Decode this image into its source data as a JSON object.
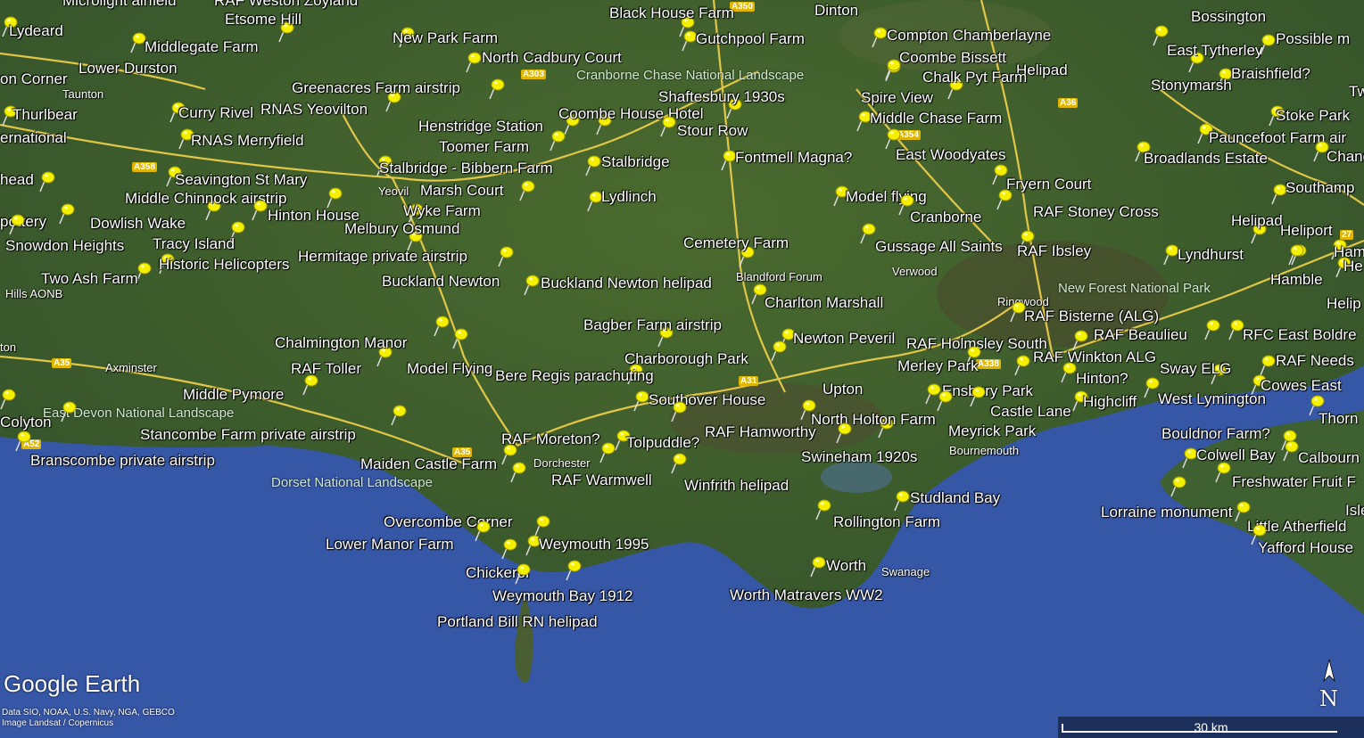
{
  "app": {
    "logo_text": "Google Earth"
  },
  "credits": {
    "line1": "Data SIO, NOAA, U.S. Navy, NGA, GEBCO",
    "line2": "Image Landsat / Copernicus"
  },
  "scale": {
    "label": "30 km"
  },
  "compass": {
    "letter": "N",
    "icon": "north-arrow-icon"
  },
  "colors": {
    "land": "#3c5c2a",
    "sea": "#3656a6",
    "road": "#f3d24a",
    "pin": "#f5f000"
  },
  "places": [
    {
      "name": "Middlegate Farm"
    },
    {
      "name": "Lower Durston"
    },
    {
      "name": "Etsome Hill"
    },
    {
      "name": "New Park Farm"
    },
    {
      "name": "North Cadbury Court"
    },
    {
      "name": "Black House Farm"
    },
    {
      "name": "Gutchpool Farm"
    },
    {
      "name": "Dinton"
    },
    {
      "name": "Compton Chamberlayne"
    },
    {
      "name": "Coombe Bissett"
    },
    {
      "name": "Helipad"
    },
    {
      "name": "Bossington"
    },
    {
      "name": "East Tytherley"
    },
    {
      "name": "Possible m"
    },
    {
      "name": "Braishfield?"
    },
    {
      "name": "Stonymarsh"
    },
    {
      "name": "Lydeard"
    },
    {
      "name": "on Corner"
    },
    {
      "name": "Thurlbear"
    },
    {
      "name": "ernational"
    },
    {
      "name": "Curry Rivel"
    },
    {
      "name": "RNAS Yeovilton"
    },
    {
      "name": "Greenacres Farm airstrip"
    },
    {
      "name": "RNAS Merryfield"
    },
    {
      "name": "Henstridge Station"
    },
    {
      "name": "Coombe House Hotel"
    },
    {
      "name": "Shaftesbury 1930s"
    },
    {
      "name": "Stour Row"
    },
    {
      "name": "Toomer Farm"
    },
    {
      "name": "Chalk Pyt Farm"
    },
    {
      "name": "Spire View"
    },
    {
      "name": "Middle Chase Farm"
    },
    {
      "name": "Stoke Park"
    },
    {
      "name": "Pauncefoot Farm air"
    },
    {
      "name": "Broadlands Estate"
    },
    {
      "name": "Chandle"
    },
    {
      "name": "head"
    },
    {
      "name": "Seavington St Mary"
    },
    {
      "name": "Stalbridge - Bibbern Farm"
    },
    {
      "name": "Stalbridge"
    },
    {
      "name": "Fontmell Magna?"
    },
    {
      "name": "East Woodyates"
    },
    {
      "name": "Fryern Court"
    },
    {
      "name": "Southamp"
    },
    {
      "name": "Middle  Chinnock airstrip"
    },
    {
      "name": "Marsh Court"
    },
    {
      "name": "Lydlinch"
    },
    {
      "name": "Model flying"
    },
    {
      "name": "Hinton House"
    },
    {
      "name": "Wyke Farm"
    },
    {
      "name": "Cranborne"
    },
    {
      "name": "RAF Stoney Cross"
    },
    {
      "name": "Helipad"
    },
    {
      "name": "Heliport"
    },
    {
      "name": "pottery"
    },
    {
      "name": "Dowlish Wake"
    },
    {
      "name": "Melbury Osmund"
    },
    {
      "name": "Snowdon Heights"
    },
    {
      "name": "Tracy Island"
    },
    {
      "name": "Cemetery Farm"
    },
    {
      "name": "Gussage All Saints"
    },
    {
      "name": "RAF Ibsley"
    },
    {
      "name": "Lyndhurst"
    },
    {
      "name": "Hamble"
    },
    {
      "name": "Hermitage private airstrip"
    },
    {
      "name": "Historic Helicopters"
    },
    {
      "name": "Two Ash Farm"
    },
    {
      "name": "Buckland Newton"
    },
    {
      "name": "Buckland Newton helipad"
    },
    {
      "name": "Hamble"
    },
    {
      "name": "Charlton Marshall"
    },
    {
      "name": "Helip"
    },
    {
      "name": "RAF Bisterne (ALG)"
    },
    {
      "name": "Bagber Farm airstrip"
    },
    {
      "name": "RAF Beaulieu"
    },
    {
      "name": "RFC East Boldre"
    },
    {
      "name": "Chalmington Manor"
    },
    {
      "name": "Newton Peveril"
    },
    {
      "name": "RAF Holmsley South"
    },
    {
      "name": "Charborough Park"
    },
    {
      "name": "RAF Winkton ALG"
    },
    {
      "name": "RAF Toller"
    },
    {
      "name": "Model Flying"
    },
    {
      "name": "Merley Park"
    },
    {
      "name": "Sway ELG"
    },
    {
      "name": "RAF Needs"
    },
    {
      "name": "Bere Regis parachuting"
    },
    {
      "name": "Hinton?"
    },
    {
      "name": "Cowes East"
    },
    {
      "name": "Middle Pymore"
    },
    {
      "name": "Upton"
    },
    {
      "name": "Ensbury Park"
    },
    {
      "name": "West Lymington"
    },
    {
      "name": "Southover House"
    },
    {
      "name": "Highcliff"
    },
    {
      "name": "Colyton"
    },
    {
      "name": "Castle Lane"
    },
    {
      "name": "Thorn"
    },
    {
      "name": "North Holton Farm"
    },
    {
      "name": "RAF Hamworthy"
    },
    {
      "name": "Meyrick Park"
    },
    {
      "name": "Stancombe Farm private airstrip"
    },
    {
      "name": "RAF Moreton?"
    },
    {
      "name": "Tolpuddle?"
    },
    {
      "name": "Bouldnor Farm?"
    },
    {
      "name": "Branscombe private airstrip"
    },
    {
      "name": "Swineham 1920s"
    },
    {
      "name": "Colwell Bay"
    },
    {
      "name": "Calbourn"
    },
    {
      "name": "Maiden Castle Farm"
    },
    {
      "name": "RAF Warmwell"
    },
    {
      "name": "Winfrith helipad"
    },
    {
      "name": "Freshwater Fruit F"
    },
    {
      "name": "Studland Bay"
    },
    {
      "name": "Lorraine monument"
    },
    {
      "name": "Overcombe Corner"
    },
    {
      "name": "Rollington Farm"
    },
    {
      "name": "Little Atherfield"
    },
    {
      "name": "Lower Manor Farm"
    },
    {
      "name": "Weymouth 1995"
    },
    {
      "name": "Yafford House"
    },
    {
      "name": "Chickerel"
    },
    {
      "name": "Worth"
    },
    {
      "name": "Weymouth Bay 1912"
    },
    {
      "name": "Worth Matravers WW2"
    },
    {
      "name": "Portland Bill RN helipad"
    },
    {
      "name": "Microlight airfield"
    },
    {
      "name": "RAF  Weston Zoyland"
    },
    {
      "name": "Tw"
    },
    {
      "name": "He"
    },
    {
      "name": "Isle"
    }
  ],
  "towns": [
    "Taunton",
    "Yeovil",
    "Axminster",
    "Blandford Forum",
    "Verwood",
    "Ringwood",
    "Dorchester",
    "Bournemouth",
    "Swanage",
    "ton",
    "Hills AONB"
  ],
  "parks": [
    "Cranborne Chase National Landscape",
    "East Devon National Landscape",
    "Dorset National Landscape",
    "New Forest National Park"
  ],
  "roads": [
    "A303",
    "A350",
    "A36",
    "A354",
    "A358",
    "A35",
    "A31",
    "A338",
    "A35",
    "A35",
    "A52",
    "27"
  ]
}
